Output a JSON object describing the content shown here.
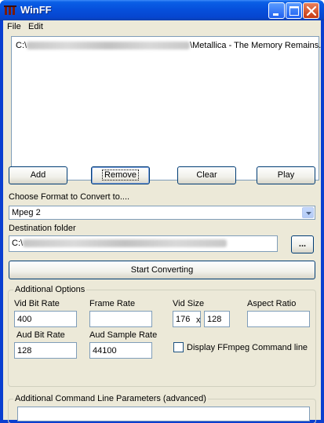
{
  "window": {
    "title": "WinFF"
  },
  "menu": {
    "file": "File",
    "edit": "Edit"
  },
  "file_list": {
    "entries": [
      {
        "prefix": "C:\\",
        "suffix": "\\Metallica - The Memory Remains."
      }
    ]
  },
  "buttons": {
    "add": "Add",
    "remove": "Remove",
    "clear": "Clear",
    "play": "Play",
    "browse": "...",
    "start": "Start Converting"
  },
  "format": {
    "label": "Choose Format to Convert to....",
    "selected": "Mpeg 2"
  },
  "destination": {
    "label": "Destination folder",
    "value": "C:\\"
  },
  "additional_options": {
    "title": "Additional Options",
    "vid_bit_rate": {
      "label": "Vid Bit Rate",
      "value": "400"
    },
    "frame_rate": {
      "label": "Frame Rate",
      "value": ""
    },
    "vid_size": {
      "label": "Vid Size",
      "width": "176",
      "sep": "x",
      "height": "128"
    },
    "aspect_ratio": {
      "label": "Aspect Ratio",
      "value": ""
    },
    "aud_bit_rate": {
      "label": "Aud Bit Rate",
      "value": "128"
    },
    "aud_sample_rate": {
      "label": "Aud Sample Rate",
      "value": "44100"
    },
    "display_cmd": {
      "label": "Display FFmpeg Command line",
      "checked": false
    }
  },
  "advanced": {
    "title": "Additional Command Line Parameters (advanced)",
    "value": ""
  },
  "colors": {
    "titlebar": "#0650dc",
    "face": "#ece9d8",
    "close": "#c73a12",
    "border": "#7f9db9"
  }
}
